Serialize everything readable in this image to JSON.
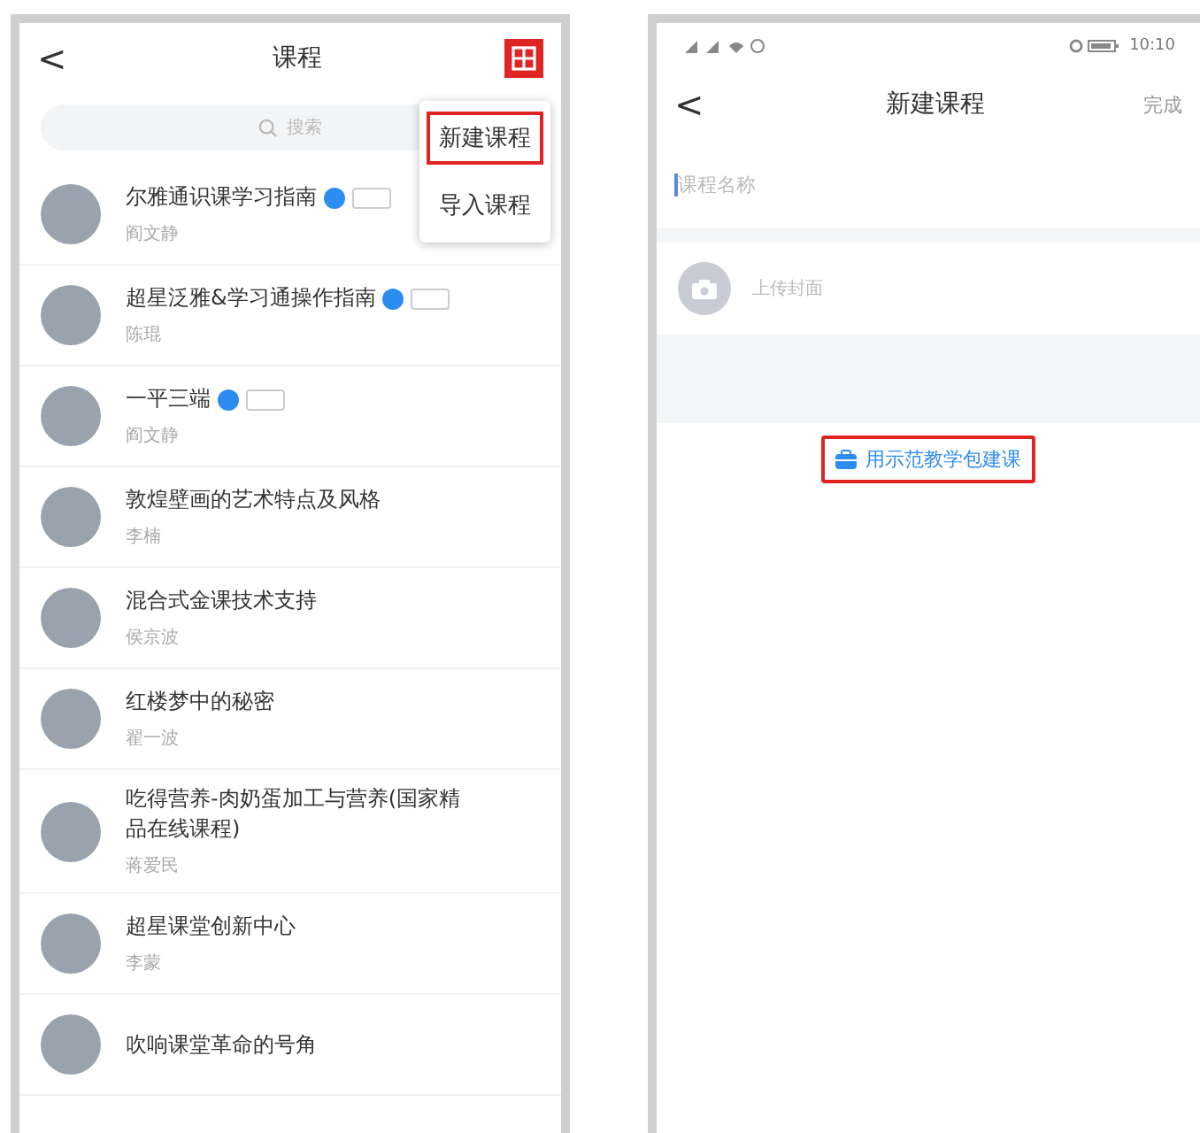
{
  "course_list_screen": {
    "nav": {
      "back": "<",
      "title": "课程",
      "add_button": {
        "annotated": true
      }
    },
    "search": {
      "placeholder": "搜索"
    },
    "menu": [
      {
        "label": "新建课程",
        "annotated": true
      },
      {
        "label": "导入课程",
        "annotated": false
      }
    ],
    "courses": [
      {
        "title": "尔雅通识课学习指南",
        "teacher": "阎文静",
        "badge": true,
        "tag": true
      },
      {
        "title": "超星泛雅&学习通操作指南",
        "teacher": "陈琨",
        "badge": true,
        "tag": true
      },
      {
        "title": "一平三端",
        "teacher": "阎文静",
        "badge": true,
        "tag": true
      },
      {
        "title": "敦煌壁画的艺术特点及风格",
        "teacher": "李楠",
        "badge": false,
        "tag": false
      },
      {
        "title": "混合式金课技术支持",
        "teacher": "侯京波",
        "badge": false,
        "tag": false
      },
      {
        "title": "红楼梦中的秘密",
        "teacher": "翟一波",
        "badge": false,
        "tag": false
      },
      {
        "title": "吃得营养-肉奶蛋加工与营养(国家精品在线课程)",
        "teacher": "蒋爱民",
        "badge": false,
        "tag": false
      },
      {
        "title": "超星课堂创新中心",
        "teacher": "李蒙",
        "badge": false,
        "tag": false
      },
      {
        "title": "吹响课堂革命的号角",
        "badge": false,
        "tag": false
      }
    ]
  },
  "new_course_screen": {
    "status_bar": {
      "time": "10:10"
    },
    "nav": {
      "back": "<",
      "title": "新建课程",
      "done": "完成"
    },
    "name_field": {
      "placeholder": "课程名称"
    },
    "cover": {
      "label": "上传封面"
    },
    "demo_button": {
      "label": "用示范教学包建课",
      "annotated": true
    }
  }
}
